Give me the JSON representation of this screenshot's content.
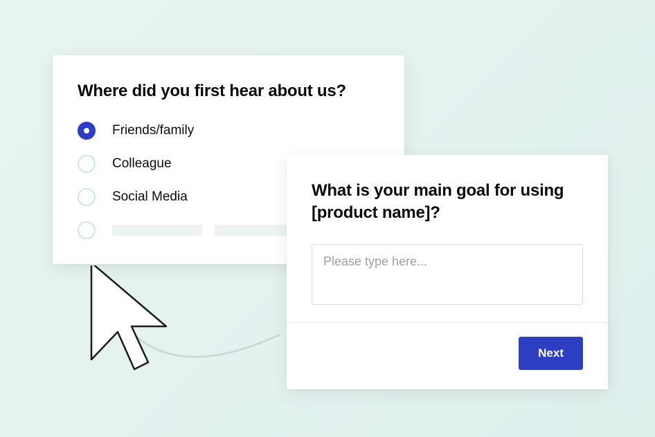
{
  "survey_left": {
    "question": "Where did you first hear about us?",
    "options": [
      {
        "label": "Friends/family",
        "selected": true
      },
      {
        "label": "Colleague",
        "selected": false
      },
      {
        "label": "Social Media",
        "selected": false
      }
    ]
  },
  "survey_right": {
    "question": "What is your main goal for using [product name]?",
    "placeholder": "Please type here...",
    "next_label": "Next"
  },
  "colors": {
    "accent": "#2d3ec2",
    "background": "#e8f4f2"
  }
}
